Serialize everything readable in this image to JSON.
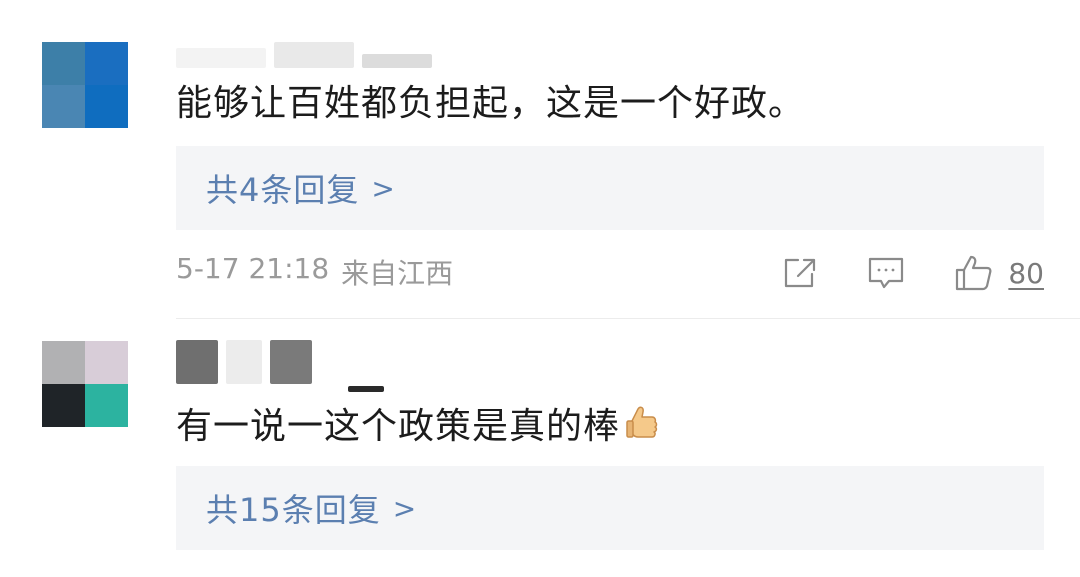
{
  "comments": [
    {
      "text": "能够让百姓都负担起，这是一个好政。",
      "replies_label": "共4条回复",
      "timestamp": "5-17 21:18",
      "location": "来自江西",
      "like_count": "80",
      "avatar_colors": [
        "#3d7fa8",
        "#1a6ec0",
        "#4a86b3",
        "#0f6dbf"
      ]
    },
    {
      "text": "有一说一这个政策是真的棒",
      "emoji": "thumbs-up",
      "replies_label": "共15条回复",
      "avatar_colors": [
        "#b1b1b3",
        "#d8cdd8",
        "#1f2428",
        "#2cb3a0"
      ]
    }
  ],
  "icons": {
    "share": "share-icon",
    "comment": "comment-icon",
    "like": "thumbs-up-icon",
    "reply_chevron": "chevron-right-icon"
  },
  "chevron_glyph": ">"
}
